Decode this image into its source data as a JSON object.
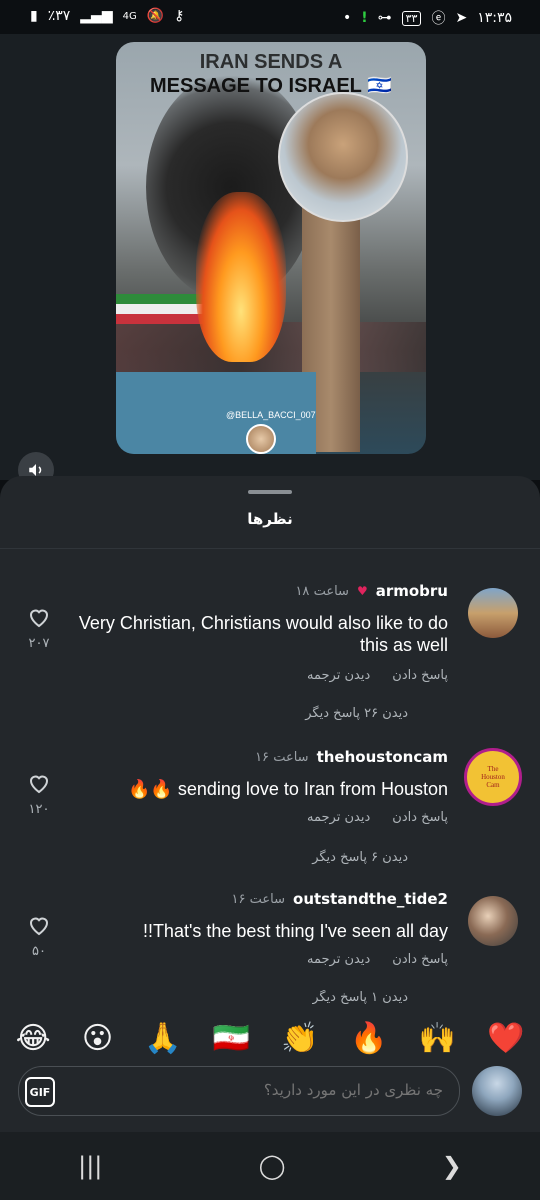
{
  "status_bar": {
    "time": "۱۳:۳۵",
    "battery": "٪۳۷",
    "network": "4G",
    "badge_count": "۳۳"
  },
  "video": {
    "caption_line1": "IRAN SENDS A",
    "caption_line2": "MESSAGE TO ISRAEL 🇮🇱",
    "watermark": "@BELLA_BACCI_007"
  },
  "sheet": {
    "title": "نظرها"
  },
  "comments": [
    {
      "user": "armobru",
      "time": "۱۸ ساعت",
      "text": "Very Christian, Christians would also like to do this as well",
      "reply": "پاسخ دادن",
      "translate": "دیدن ترجمه",
      "more_replies": "دیدن ۲۶ پاسخ دیگر",
      "likes": "۲۰۷"
    },
    {
      "user": "thehoustoncam",
      "time": "۱۶ ساعت",
      "text": "🔥🔥 sending love to Iran from Houston",
      "reply": "پاسخ دادن",
      "translate": "دیدن ترجمه",
      "more_replies": "دیدن ۶ پاسخ دیگر",
      "likes": "۱۲۰",
      "avatar_text": "The Houston Cam"
    },
    {
      "user": "outstandthe_tide2",
      "time": "۱۶ ساعت",
      "text": "!!That's the best thing I've seen all day",
      "reply": "پاسخ دادن",
      "translate": "دیدن ترجمه",
      "more_replies": "دیدن ۱ پاسخ دیگر",
      "likes": "۵۰"
    }
  ],
  "emojis": [
    "😂",
    "😮",
    "🙏",
    "🇮🇷",
    "👏",
    "🔥",
    "🙌",
    "❤️"
  ],
  "composer": {
    "placeholder": "چه نظری در این مورد دارید؟",
    "gif_label": "GIF"
  },
  "colors": {
    "sheet_bg": "#23272b",
    "like_red": "#e0245e"
  }
}
